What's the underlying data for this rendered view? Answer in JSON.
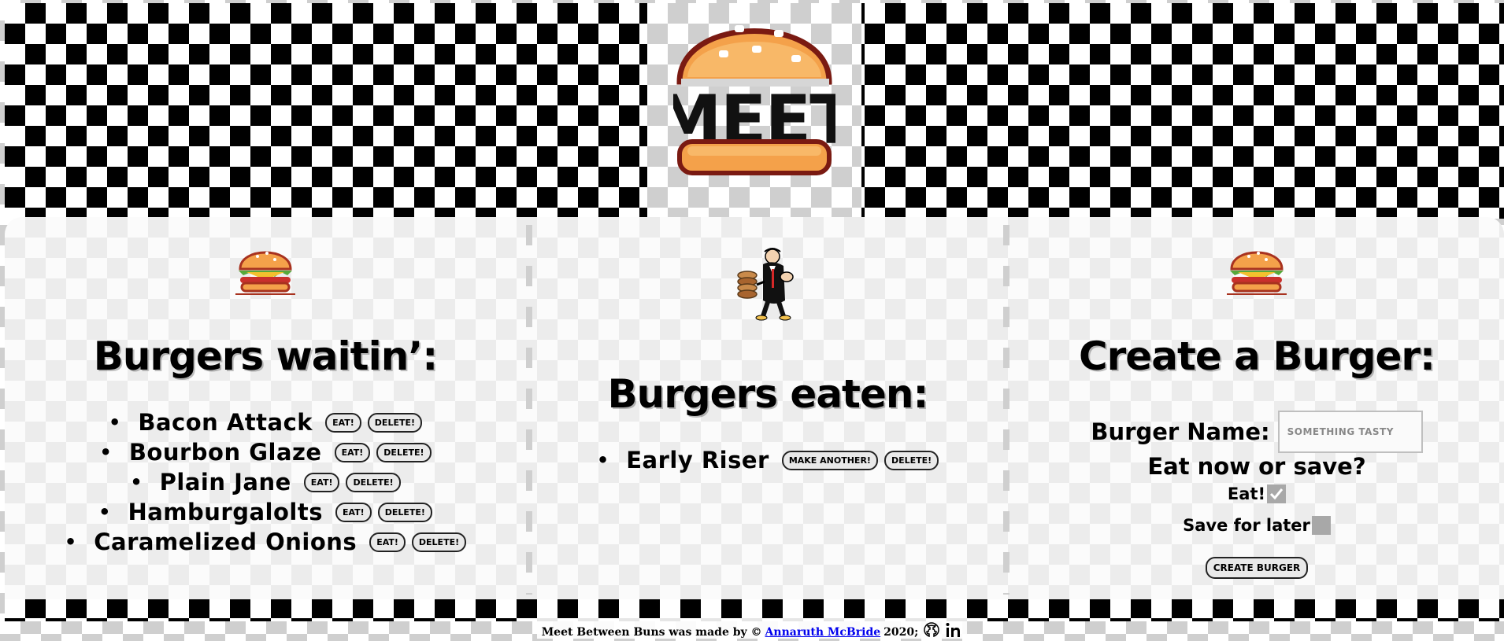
{
  "logo": {
    "text": "MEET"
  },
  "waiting": {
    "heading": "Burgers waitin’:",
    "items": [
      {
        "name": "Bacon Attack",
        "eat": "Eat!",
        "delete": "Delete!"
      },
      {
        "name": "Bourbon Glaze",
        "eat": "Eat!",
        "delete": "Delete!"
      },
      {
        "name": "Plain Jane",
        "eat": "Eat!",
        "delete": "Delete!"
      },
      {
        "name": "Hamburgalolts",
        "eat": "Eat!",
        "delete": "Delete!"
      },
      {
        "name": "Caramelized Onions",
        "eat": "Eat!",
        "delete": "Delete!"
      }
    ]
  },
  "eaten": {
    "heading": "Burgers eaten:",
    "items": [
      {
        "name": "Early Riser",
        "again": "Make another!",
        "delete": "Delete!"
      }
    ]
  },
  "create": {
    "heading": "Create a Burger:",
    "name_label": "Burger Name:",
    "name_placeholder": "Something tasty",
    "question": "Eat now or save?",
    "eat_label": "Eat!",
    "eat_checked": true,
    "save_label": "Save for later",
    "save_checked": false,
    "submit": "Create Burger"
  },
  "footer": {
    "text_before": "Meet Between Buns was made by ©",
    "author": "Annaruth McBride",
    "year": "2020;"
  }
}
